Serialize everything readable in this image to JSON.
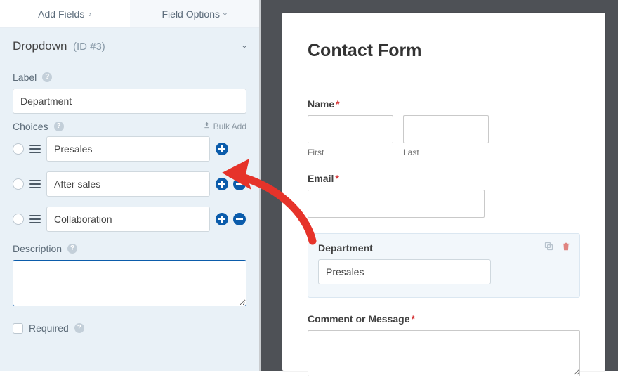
{
  "tabs": {
    "add_fields": "Add Fields",
    "field_options": "Field Options"
  },
  "group": {
    "title": "Dropdown",
    "id_text": "(ID #3)"
  },
  "labels": {
    "label": "Label",
    "choices": "Choices",
    "bulk_add": "Bulk Add",
    "description": "Description",
    "required": "Required"
  },
  "label_value": "Department",
  "choices": [
    {
      "value": "Presales",
      "show_remove": false
    },
    {
      "value": "After sales",
      "show_remove": true
    },
    {
      "value": "Collaboration",
      "show_remove": true
    }
  ],
  "description_value": "",
  "preview": {
    "title": "Contact Form",
    "name_label": "Name",
    "first_sub": "First",
    "last_sub": "Last",
    "email_label": "Email",
    "department_label": "Department",
    "department_selected": "Presales",
    "comment_label": "Comment or Message"
  }
}
